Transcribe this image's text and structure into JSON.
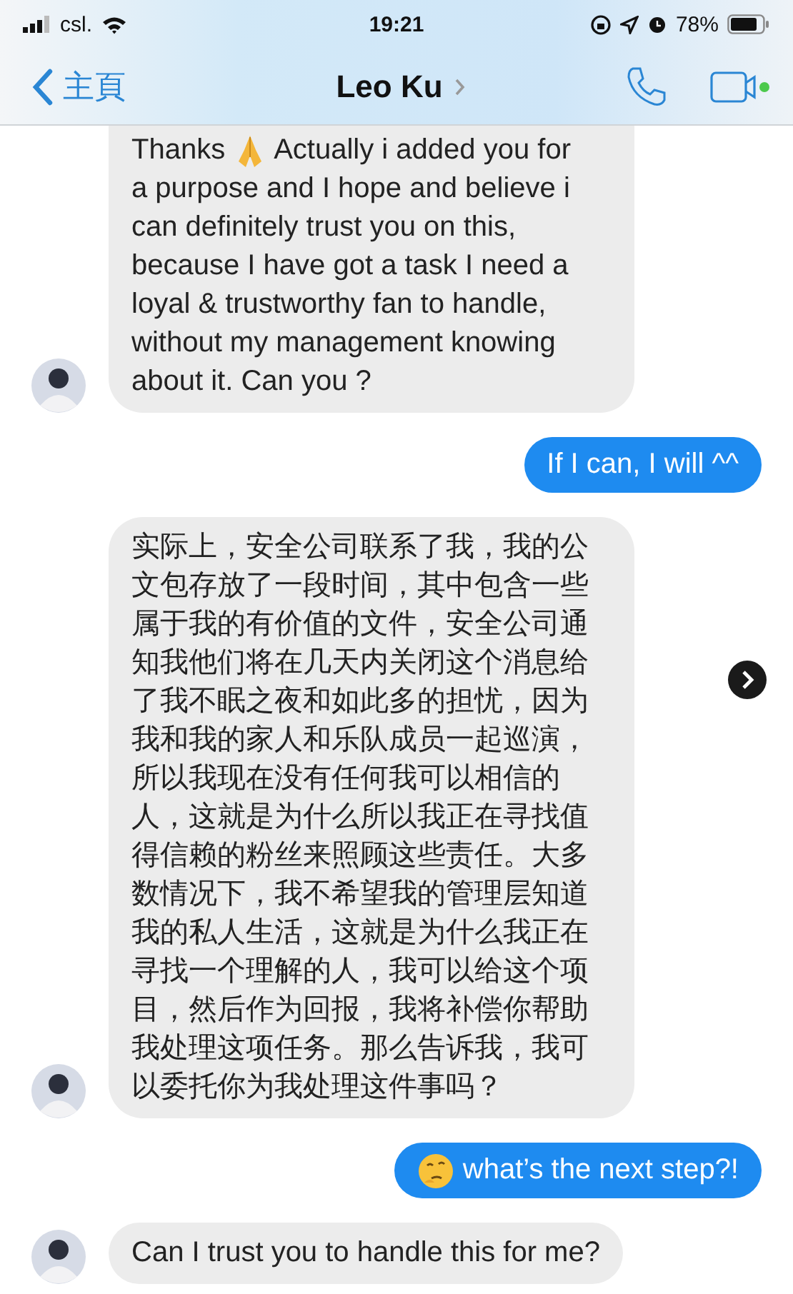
{
  "status_bar": {
    "carrier": "csl.",
    "time": "19:21",
    "battery": "78%"
  },
  "header": {
    "back_label": "主頁",
    "contact_name": "Leo Ku",
    "video_online": true
  },
  "messages": [
    {
      "kind": "received",
      "lead": [
        {
          "kind": "text",
          "text": "Thanks"
        },
        {
          "kind": "praying_hands"
        },
        {
          "kind": "text",
          "text": "Actually i added you for"
        }
      ],
      "text": "a purpose and I hope and believe i can definitely trust you on this, because I have got a task I need a loyal & trustworthy fan to handle, without my management knowing about it. Can you ?"
    },
    {
      "kind": "sent",
      "text": "If I can, I will ^^"
    },
    {
      "kind": "received",
      "text": "实际上，安全公司联系了我，我的公文包存放了一段时间，其中包含一些属于我的有价值的文件，安全公司通知我他们将在几天内关闭这个消息给了我不眠之夜和如此多的担忧，因为我和我的家人和乐队成员一起巡演，所以我现在没有任何我可以相信的人，这就是为什么所以我正在寻找值得信赖的粉丝来照顾这些责任。大多数情况下，我不希望我的管理层知道我的私人生活，这就是为什么我正在寻找一个理解的人，我可以给这个项目，然后作为回报，我将补偿你帮助我处理这项任务。那么告诉我，我可以委托你为我处理这件事吗？",
      "forward": true
    },
    {
      "kind": "sent",
      "lead": [
        {
          "kind": "thinking_face"
        },
        {
          "kind": "text",
          "text": "what’s the next step?!"
        }
      ]
    },
    {
      "kind": "received",
      "text": "Can I trust you to handle this for me?"
    }
  ]
}
